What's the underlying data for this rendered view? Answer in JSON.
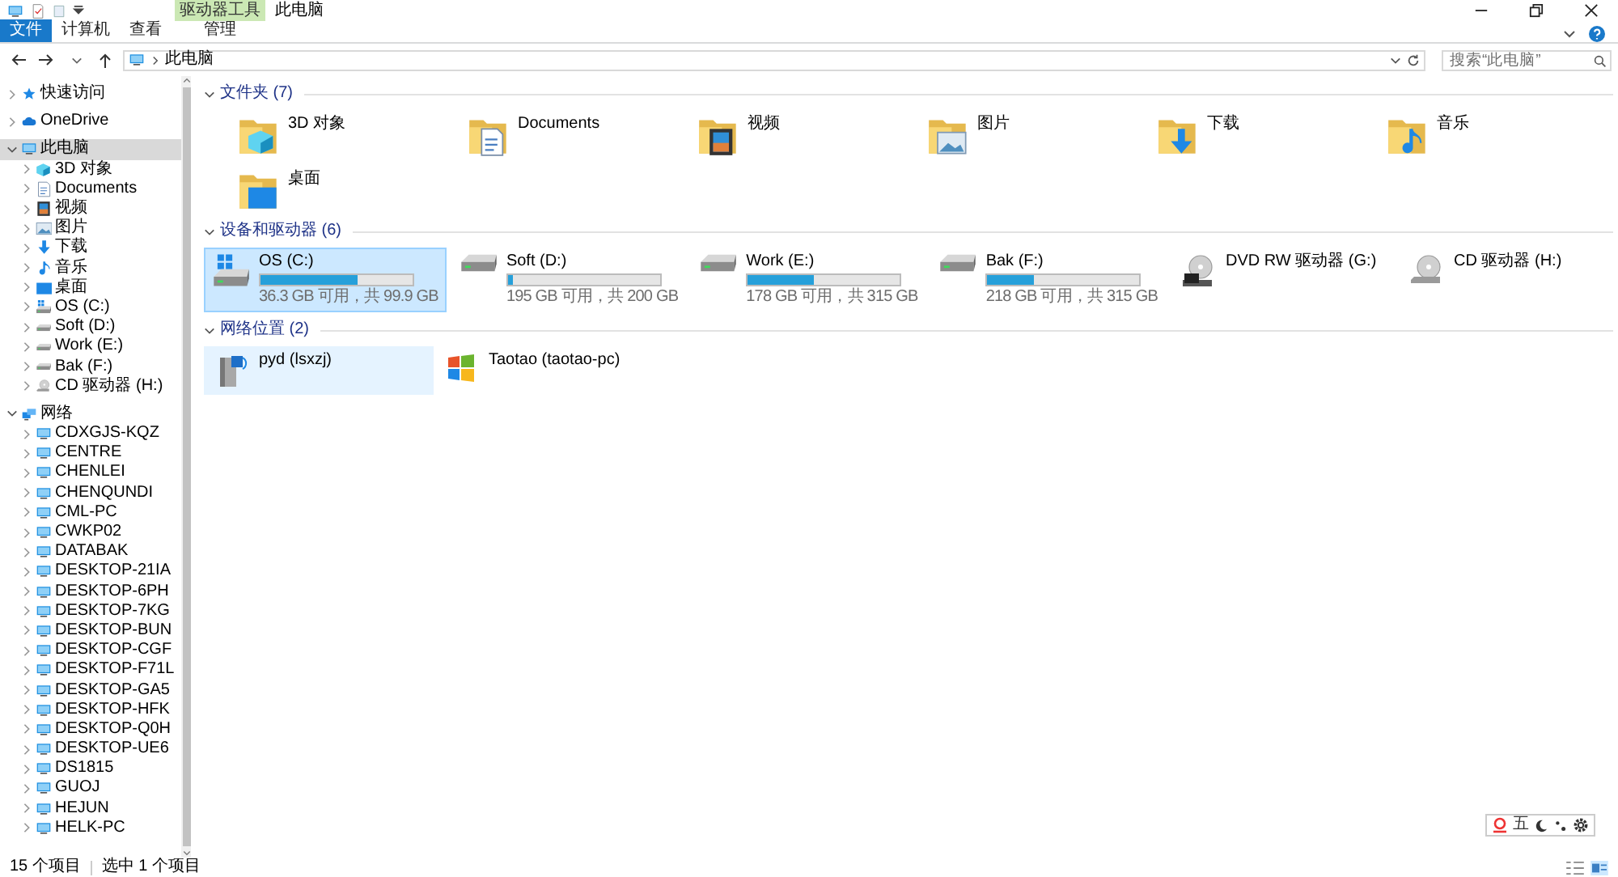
{
  "window": {
    "context_group": "驱动器工具",
    "title": "此电脑"
  },
  "ribbon": {
    "tabs": [
      {
        "label": "文件",
        "kind": "file"
      },
      {
        "label": "计算机",
        "kind": "tab"
      },
      {
        "label": "查看",
        "kind": "tab"
      },
      {
        "label": "管理",
        "kind": "context"
      }
    ]
  },
  "address": {
    "path": "此电脑",
    "search_placeholder": "搜索“此电脑”"
  },
  "sidebar": {
    "items": [
      {
        "label": "快速访问",
        "kind": "star",
        "expanded": false,
        "selected": false
      },
      {
        "label": "OneDrive",
        "kind": "cloud",
        "expanded": false,
        "selected": false
      },
      {
        "label": "此电脑",
        "kind": "pc",
        "expanded": true,
        "selected": true,
        "children": [
          {
            "label": "3D 对象",
            "kind": "cube",
            "expanded": false,
            "selected": false
          },
          {
            "label": "Documents",
            "kind": "doc",
            "expanded": false,
            "selected": false
          },
          {
            "label": "视频",
            "kind": "film",
            "expanded": false,
            "selected": false
          },
          {
            "label": "图片",
            "kind": "picture",
            "expanded": false,
            "selected": false
          },
          {
            "label": "下载",
            "kind": "download",
            "expanded": false,
            "selected": false
          },
          {
            "label": "音乐",
            "kind": "music",
            "expanded": false,
            "selected": false
          },
          {
            "label": "桌面",
            "kind": "desktop",
            "expanded": false,
            "selected": false
          },
          {
            "label": "OS (C:)",
            "kind": "windrive",
            "expanded": false,
            "selected": false
          },
          {
            "label": "Soft (D:)",
            "kind": "drive",
            "expanded": false,
            "selected": false
          },
          {
            "label": "Work (E:)",
            "kind": "drive",
            "expanded": false,
            "selected": false
          },
          {
            "label": "Bak (F:)",
            "kind": "drive",
            "expanded": false,
            "selected": false
          },
          {
            "label": "CD 驱动器 (H:)",
            "kind": "cd",
            "expanded": false,
            "selected": false
          }
        ]
      },
      {
        "label": "网络",
        "kind": "network",
        "expanded": true,
        "selected": false,
        "children": [
          {
            "label": "CDXGJS-KQZ",
            "kind": "pc",
            "expanded": false,
            "selected": false
          },
          {
            "label": "CENTRE",
            "kind": "pc",
            "expanded": false,
            "selected": false
          },
          {
            "label": "CHENLEI",
            "kind": "pc",
            "expanded": false,
            "selected": false
          },
          {
            "label": "CHENQUNDI",
            "kind": "pc",
            "expanded": false,
            "selected": false
          },
          {
            "label": "CML-PC",
            "kind": "pc",
            "expanded": false,
            "selected": false
          },
          {
            "label": "CWKP02",
            "kind": "pc",
            "expanded": false,
            "selected": false
          },
          {
            "label": "DATABAK",
            "kind": "pc",
            "expanded": false,
            "selected": false
          },
          {
            "label": "DESKTOP-21IA",
            "kind": "pc",
            "expanded": false,
            "selected": false
          },
          {
            "label": "DESKTOP-6PH",
            "kind": "pc",
            "expanded": false,
            "selected": false
          },
          {
            "label": "DESKTOP-7KG",
            "kind": "pc",
            "expanded": false,
            "selected": false
          },
          {
            "label": "DESKTOP-BUN",
            "kind": "pc",
            "expanded": false,
            "selected": false
          },
          {
            "label": "DESKTOP-CGF",
            "kind": "pc",
            "expanded": false,
            "selected": false
          },
          {
            "label": "DESKTOP-F71L",
            "kind": "pc",
            "expanded": false,
            "selected": false
          },
          {
            "label": "DESKTOP-GA5",
            "kind": "pc",
            "expanded": false,
            "selected": false
          },
          {
            "label": "DESKTOP-HFK",
            "kind": "pc",
            "expanded": false,
            "selected": false
          },
          {
            "label": "DESKTOP-Q0H",
            "kind": "pc",
            "expanded": false,
            "selected": false
          },
          {
            "label": "DESKTOP-UE6",
            "kind": "pc",
            "expanded": false,
            "selected": false
          },
          {
            "label": "DS1815",
            "kind": "pc",
            "expanded": false,
            "selected": false
          },
          {
            "label": "GUOJ",
            "kind": "pc",
            "expanded": false,
            "selected": false
          },
          {
            "label": "HEJUN",
            "kind": "pc",
            "expanded": false,
            "selected": false
          },
          {
            "label": "HELK-PC",
            "kind": "pc",
            "expanded": false,
            "selected": false
          }
        ]
      }
    ]
  },
  "sections": [
    {
      "title": "文件夹 (7)",
      "expanded": true,
      "items": [
        {
          "label": "3D 对象",
          "kind": "cube",
          "selected": false,
          "hovered": false
        },
        {
          "label": "Documents",
          "kind": "doc",
          "selected": false,
          "hovered": false
        },
        {
          "label": "视频",
          "kind": "film",
          "selected": false,
          "hovered": false
        },
        {
          "label": "图片",
          "kind": "picture",
          "selected": false,
          "hovered": false
        },
        {
          "label": "下载",
          "kind": "download",
          "selected": false,
          "hovered": false
        },
        {
          "label": "音乐",
          "kind": "music",
          "selected": false,
          "hovered": false
        },
        {
          "label": "桌面",
          "kind": "desktop",
          "selected": false,
          "hovered": false
        }
      ]
    },
    {
      "title": "设备和驱动器 (6)",
      "expanded": true,
      "items": [
        {
          "label": "OS (C:)",
          "kind": "windrive",
          "level": 0.64,
          "caption": "36.3 GB 可用，共 99.9 GB",
          "selected": true,
          "hovered": false
        },
        {
          "label": "Soft (D:)",
          "kind": "drive",
          "level": 0.03,
          "caption": "195 GB 可用，共 200 GB",
          "selected": false,
          "hovered": false
        },
        {
          "label": "Work (E:)",
          "kind": "drive",
          "level": 0.43,
          "caption": "178 GB 可用，共 315 GB",
          "selected": false,
          "hovered": false
        },
        {
          "label": "Bak (F:)",
          "kind": "drive",
          "level": 0.31,
          "caption": "218 GB 可用，共 315 GB",
          "selected": false,
          "hovered": false
        },
        {
          "label": "DVD RW 驱动器 (G:)",
          "kind": "dvd",
          "selected": false,
          "hovered": false
        },
        {
          "label": "CD 驱动器 (H:)",
          "kind": "cd",
          "selected": false,
          "hovered": false
        }
      ]
    },
    {
      "title": "网络位置 (2)",
      "expanded": true,
      "items": [
        {
          "label": "pyd (lsxzj)",
          "kind": "netdrive",
          "selected": false,
          "hovered": true
        },
        {
          "label": "Taotao (taotao-pc)",
          "kind": "wmp",
          "selected": false,
          "hovered": false
        }
      ]
    }
  ],
  "status_bar": {
    "count": "15 个项目",
    "selection": "选中 1 个项目"
  },
  "ime_toolbar": {
    "mode": "五"
  }
}
